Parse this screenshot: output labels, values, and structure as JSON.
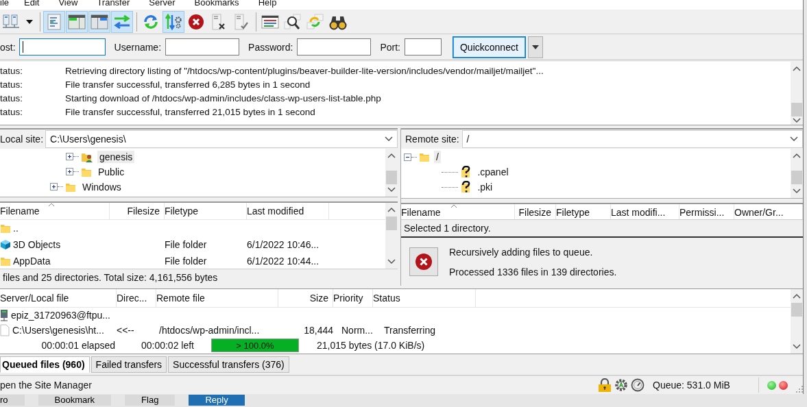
{
  "menu": [
    "ile",
    "Edit",
    "View",
    "Transfer",
    "Server",
    "Bookmarks",
    "Help"
  ],
  "toolbar": [
    {
      "kind": "site-manager",
      "selected": false
    },
    {
      "kind": "dropdown",
      "selected": false
    },
    {
      "kind": "log",
      "selected": true
    },
    {
      "kind": "local-tree",
      "selected": true
    },
    {
      "kind": "remote-tree",
      "selected": true
    },
    {
      "kind": "queue",
      "selected": true
    },
    {
      "kind": "refresh",
      "selected": false
    },
    {
      "kind": "process-queue",
      "selected": true
    },
    {
      "kind": "cancel",
      "selected": false
    },
    {
      "kind": "disconnect",
      "selected": false
    },
    {
      "kind": "reconnect",
      "selected": false
    },
    {
      "kind": "filter",
      "selected": false
    },
    {
      "kind": "compare",
      "selected": false
    },
    {
      "kind": "sync",
      "selected": false
    },
    {
      "kind": "find",
      "selected": false
    }
  ],
  "quickconnect": {
    "host_label": "ost:",
    "username_label": "Username:",
    "password_label": "Password:",
    "port_label": "Port:",
    "button": "Quickconnect"
  },
  "log": [
    {
      "label": "tatus:",
      "message": "Retrieving directory listing of \"/htdocs/wp-content/plugins/beaver-builder-lite-version/includes/vendor/mailjet/mailjet\"..."
    },
    {
      "label": "tatus:",
      "message": "File transfer successful, transferred 6,285 bytes in 1 second"
    },
    {
      "label": "tatus:",
      "message": "Starting download of /htdocs/wp-admin/includes/class-wp-users-list-table.php"
    },
    {
      "label": "tatus:",
      "message": "File transfer successful, transferred 21,015 bytes in 1 second"
    }
  ],
  "local_site": {
    "label": "Local site:",
    "path": "C:\\Users\\genesis\\",
    "tree": [
      {
        "children": [
          {
            "label": "genesis",
            "kind": "user-folder",
            "expanded": false,
            "selected": true
          },
          {
            "label": "Public",
            "kind": "folder",
            "expanded": false,
            "selected": false
          }
        ]
      },
      {
        "label": "Windows",
        "kind": "folder",
        "expanded": false,
        "selected": false
      }
    ],
    "columns": [
      "Filename",
      "Filesize",
      "Filetype",
      "Last modified"
    ],
    "rows": [
      {
        "kind": "folder",
        "cells": [
          "..",
          "",
          "",
          ""
        ]
      },
      {
        "kind": "cube",
        "cells": [
          "3D Objects",
          "",
          "File folder",
          "6/1/2022 10:46..."
        ]
      },
      {
        "kind": "folder",
        "cells": [
          "AppData",
          "",
          "File folder",
          "6/1/2022 10:44..."
        ]
      }
    ],
    "status": "files and 25 directories. Total size: 4,161,556 bytes"
  },
  "remote_site": {
    "label": "Remote site:",
    "path": "/",
    "tree": [
      {
        "label": "/",
        "kind": "folder",
        "expanded": true,
        "selected": true,
        "children": [
          {
            "label": ".cpanel",
            "kind": "unknown",
            "selected": false
          },
          {
            "label": ".pki",
            "kind": "unknown",
            "selected": false
          }
        ]
      }
    ],
    "columns": [
      "Filename",
      "Filesize",
      "Filetype",
      "Last modifi...",
      "Permissi...",
      "Owner/Gr..."
    ],
    "status": "Selected 1 directory.",
    "notice": [
      "Recursively adding files to queue.",
      "Processed 1336 files in 139 directories."
    ]
  },
  "queue": {
    "columns": [
      "Server/Local file",
      "Direc...",
      "Remote file",
      "Size",
      "Priority",
      "Status"
    ],
    "server": "epiz_31720963@ftpu...",
    "file": [
      "C:\\Users\\genesis\\ht...",
      "<<--",
      "/htdocs/wp-admin/incl...",
      "18,444",
      "Norm...",
      "Transferring"
    ],
    "progress": {
      "elapsed": "00:00:01 elapsed",
      "left": "00:00:02 left",
      "level": 1.0,
      "label": "> 100.0%",
      "bytes": "21,015 bytes (17.0 KiB/s)"
    }
  },
  "tabs": [
    {
      "label": "Queued files (960)",
      "selected": true
    },
    {
      "label": "Failed transfers",
      "selected": false
    },
    {
      "label": "Successful transfers (376)",
      "selected": false
    }
  ],
  "status_bar": {
    "message": "pen the Site Manager",
    "queue": "Queue: 531.0 MiB"
  },
  "taskbar": [
    {
      "label": "ro",
      "kind": "plain"
    },
    {
      "label": "Bookmark",
      "kind": "plain"
    },
    {
      "label": "Flag",
      "kind": "plain"
    },
    {
      "label": "Reply",
      "kind": "primary"
    }
  ]
}
